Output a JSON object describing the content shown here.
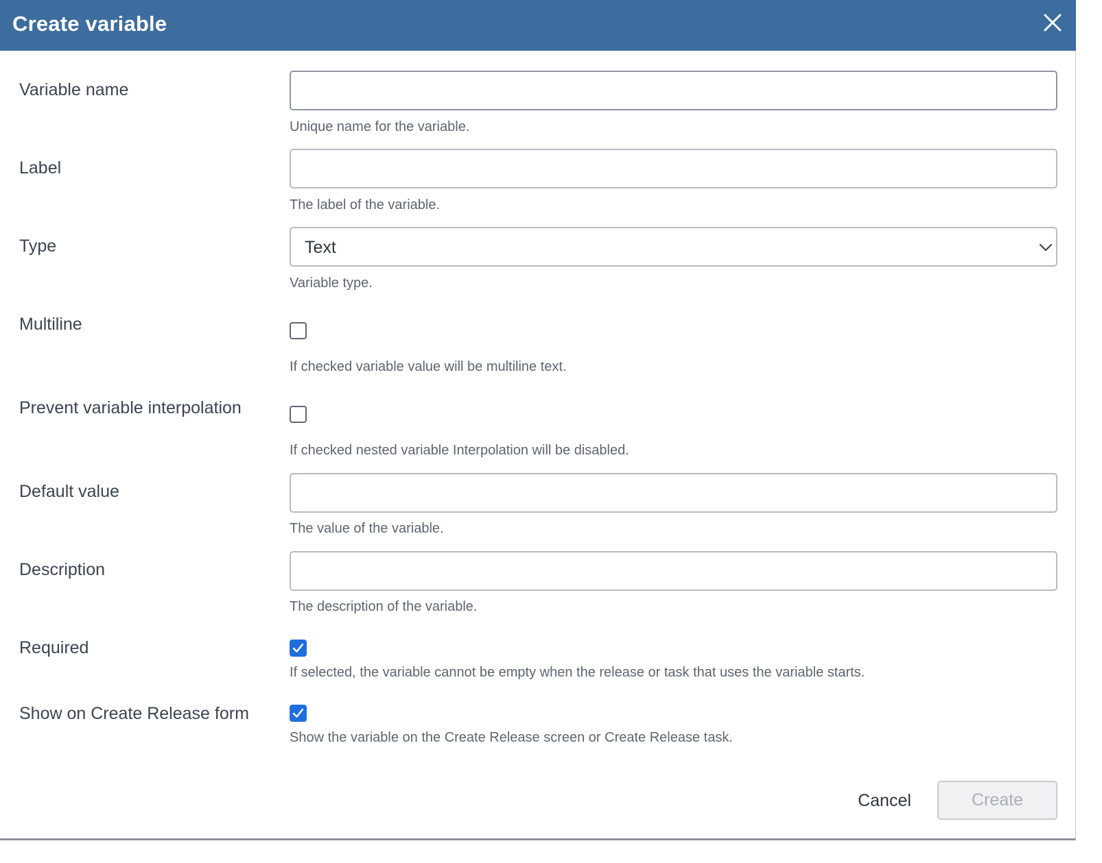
{
  "dialog": {
    "title": "Create variable",
    "close_icon": "close-icon",
    "header_color": "#3d6d9e"
  },
  "fields": {
    "variable_name": {
      "label": "Variable name",
      "value": "",
      "help": "Unique name for the variable."
    },
    "label": {
      "label": "Label",
      "value": "",
      "help": "The label of the variable."
    },
    "type": {
      "label": "Type",
      "selected": "Text",
      "help": "Variable type.",
      "icon": "chevron-down-icon"
    },
    "multiline": {
      "label": "Multiline",
      "checked": false,
      "help": "If checked variable value will be multiline text."
    },
    "prevent_interpolation": {
      "label": "Prevent variable interpolation",
      "checked": false,
      "help": "If checked nested variable Interpolation will be disabled."
    },
    "default_value": {
      "label": "Default value",
      "value": "",
      "help": "The value of the variable."
    },
    "description": {
      "label": "Description",
      "value": "",
      "help": "The description of the variable."
    },
    "required": {
      "label": "Required",
      "checked": true,
      "help": "If selected, the variable cannot be empty when the release or task that uses the variable starts."
    },
    "show_on_create_release": {
      "label": "Show on Create Release form",
      "checked": true,
      "help": "Show the variable on the Create Release screen or Create Release task."
    }
  },
  "footer": {
    "cancel_label": "Cancel",
    "create_label": "Create",
    "create_disabled": true
  },
  "colors": {
    "checkbox_checked": "#1f6ee0",
    "label_text": "#3b4450",
    "help_text": "#5d6570"
  }
}
